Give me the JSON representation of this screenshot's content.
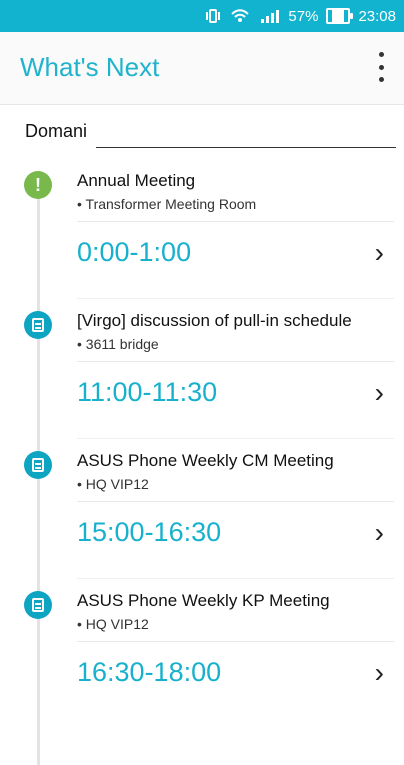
{
  "status_bar": {
    "battery_percent": "57%",
    "time": "23:08",
    "icons": [
      "vibrate-icon",
      "wifi-icon",
      "signal-icon",
      "battery-icon"
    ]
  },
  "app": {
    "title": "What's Next"
  },
  "section": {
    "title": "Domani"
  },
  "events": [
    {
      "title": "Annual Meeting",
      "location": "• Transformer Meeting Room",
      "time": "0:00-1:00",
      "icon": "alert"
    },
    {
      "title": "[Virgo] discussion of pull-in schedule",
      "location": "• 3611 bridge",
      "time": "11:00-11:30",
      "icon": "note"
    },
    {
      "title": "ASUS Phone Weekly CM Meeting",
      "location": "• HQ VIP12",
      "time": "15:00-16:30",
      "icon": "note"
    },
    {
      "title": "ASUS Phone Weekly KP Meeting",
      "location": "• HQ VIP12",
      "time": "16:30-18:00",
      "icon": "note"
    }
  ],
  "colors": {
    "accent": "#18b1cd",
    "statusbar": "#12b3cf",
    "alert_icon": "#79b84a",
    "note_icon": "#0ea5c3"
  }
}
